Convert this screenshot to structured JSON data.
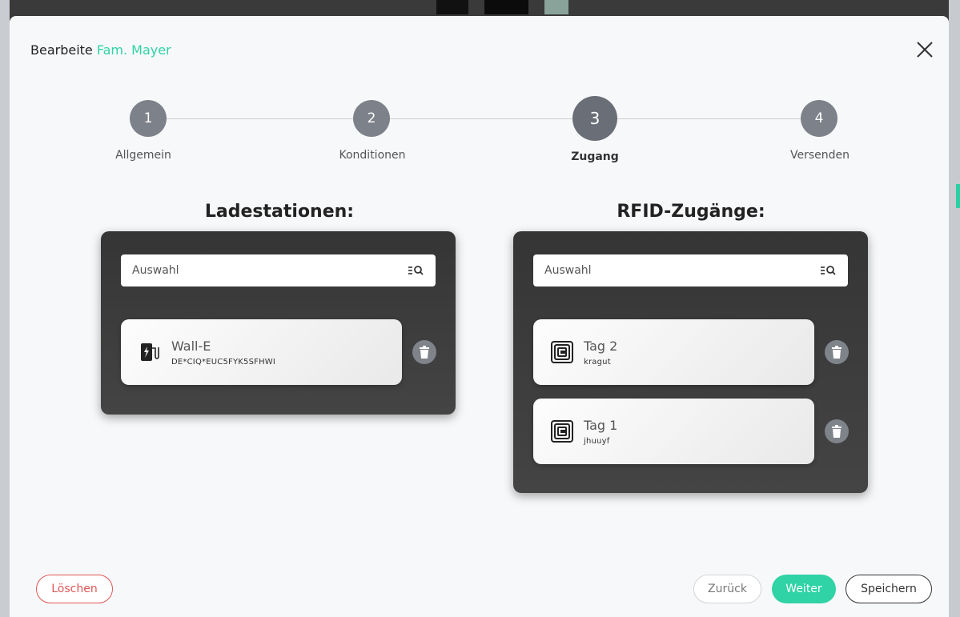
{
  "modal": {
    "title_prefix": "Bearbeite",
    "title_name": "Fam. Mayer"
  },
  "stepper": {
    "steps": [
      {
        "number": "1",
        "label": "Allgemein",
        "active": false
      },
      {
        "number": "2",
        "label": "Konditionen",
        "active": false
      },
      {
        "number": "3",
        "label": "Zugang",
        "active": true
      },
      {
        "number": "4",
        "label": "Versenden",
        "active": false
      }
    ]
  },
  "ladestationen": {
    "title": "Ladestationen:",
    "search_placeholder": "Auswahl",
    "items": [
      {
        "name": "Wall-E",
        "id": "DE*CIQ*EUC5FYK5SFHWI",
        "icon": "ev-charger-icon"
      }
    ]
  },
  "rfid": {
    "title": "RFID-Zugänge:",
    "search_placeholder": "Auswahl",
    "items": [
      {
        "name": "Tag 2",
        "id": "kragut",
        "icon": "rfid-tag-icon"
      },
      {
        "name": "Tag 1",
        "id": "jhuuyf",
        "icon": "rfid-tag-icon"
      }
    ]
  },
  "footer": {
    "delete_label": "Löschen",
    "back_label": "Zurück",
    "next_label": "Weiter",
    "save_label": "Speichern"
  },
  "colors": {
    "accent": "#2fd3a5",
    "danger": "#e05656",
    "step": "#7d8189"
  }
}
